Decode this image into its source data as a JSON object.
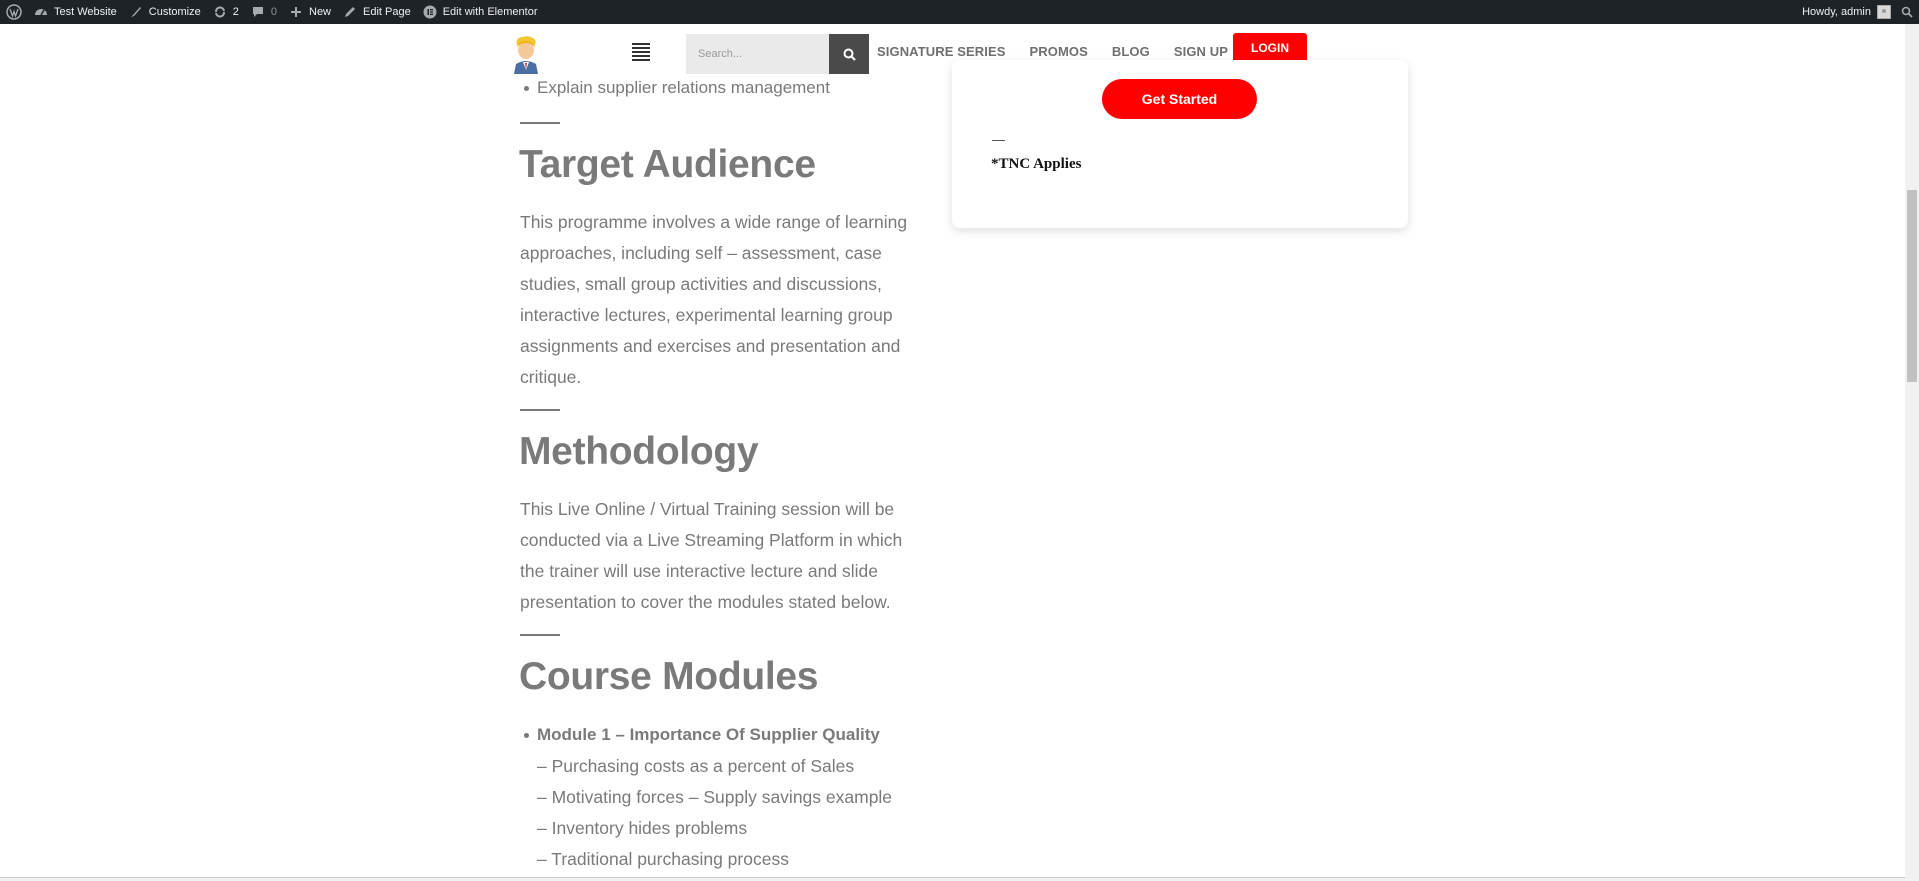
{
  "admin_bar": {
    "site_name": "Test Website",
    "customize": "Customize",
    "updates_count": "2",
    "comments_count": "0",
    "new": "New",
    "edit_page": "Edit Page",
    "edit_elementor": "Edit with Elementor",
    "howdy": "Howdy, admin"
  },
  "header": {
    "search_placeholder": "Search...",
    "nav": [
      "SIGNATURE SERIES",
      "PROMOS",
      "BLOG",
      "SIGN UP"
    ],
    "login": "LOGIN"
  },
  "card": {
    "cta": "Get Started",
    "tnc": "*TNC Applies"
  },
  "content": {
    "top_bullet": "Explain supplier relations management",
    "target_heading": "Target Audience",
    "target_lines": [
      "This programme involves a wide range of learning",
      "approaches, including self – assessment, case",
      "studies, small group activities and discussions,",
      "interactive lectures, experimental learning group",
      "assignments and exercises and presentation and",
      "critique."
    ],
    "method_heading": "Methodology",
    "method_lines": [
      "This Live Online / Virtual Training session will be",
      "conducted via a Live Streaming Platform in which",
      "the trainer will use interactive lecture and slide",
      "presentation to cover the modules stated below."
    ],
    "modules_heading": "Course Modules",
    "module1_title": "Module 1 – Importance Of Supplier Quality",
    "module1_items": [
      "– Purchasing costs as a percent of Sales",
      "– Motivating forces – Supply savings example",
      "– Inventory hides problems",
      "– Traditional purchasing process"
    ]
  }
}
